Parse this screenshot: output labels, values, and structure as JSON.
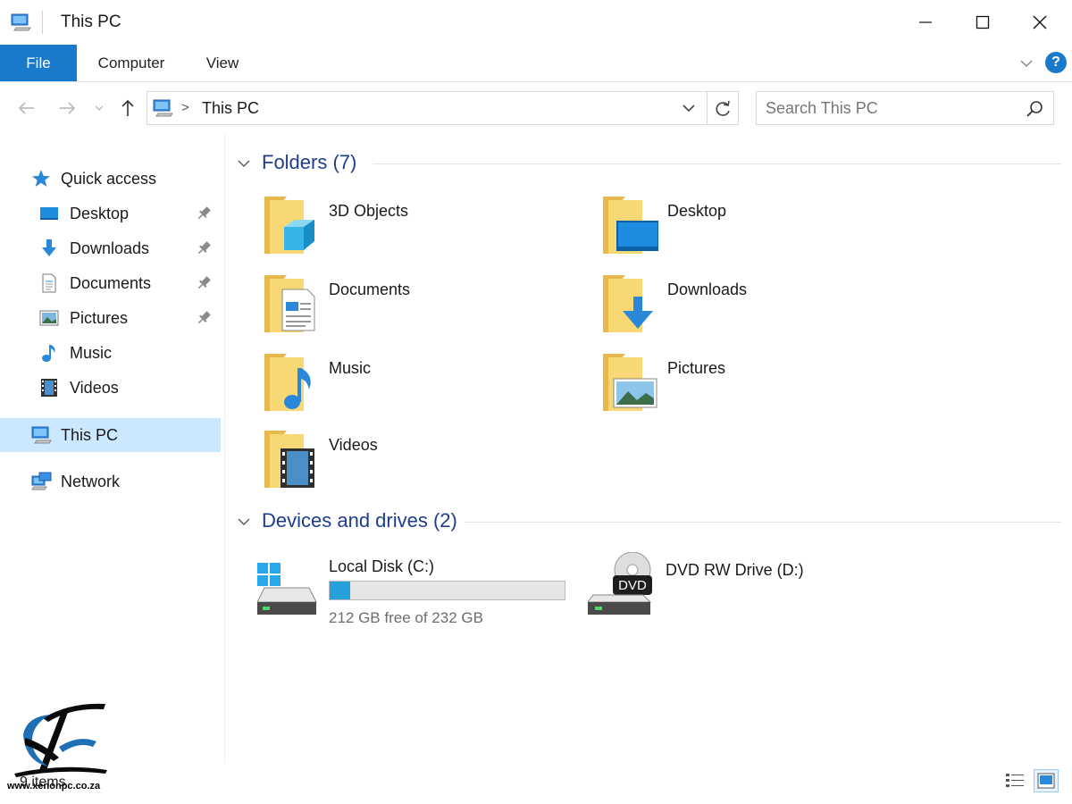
{
  "window": {
    "title": "This PC"
  },
  "ribbon": {
    "tabs": [
      {
        "label": "File"
      },
      {
        "label": "Computer"
      },
      {
        "label": "View"
      }
    ],
    "help_label": "?"
  },
  "address": {
    "path": "This PC",
    "separator": ">"
  },
  "search": {
    "placeholder": "Search This PC"
  },
  "sidebar": {
    "quick_access": "Quick access",
    "pinned": [
      {
        "label": "Desktop",
        "icon": "desktop-icon"
      },
      {
        "label": "Downloads",
        "icon": "downloads-icon"
      },
      {
        "label": "Documents",
        "icon": "documents-icon"
      },
      {
        "label": "Pictures",
        "icon": "pictures-icon"
      }
    ],
    "unpinned": [
      {
        "label": "Music",
        "icon": "music-icon"
      },
      {
        "label": "Videos",
        "icon": "videos-icon"
      }
    ],
    "this_pc": "This PC",
    "network": "Network"
  },
  "folders": {
    "header": "Folders (7)",
    "items": [
      {
        "name": "3D Objects",
        "icon": "3d-objects-folder-icon"
      },
      {
        "name": "Desktop",
        "icon": "desktop-folder-icon"
      },
      {
        "name": "Documents",
        "icon": "documents-folder-icon"
      },
      {
        "name": "Downloads",
        "icon": "downloads-folder-icon"
      },
      {
        "name": "Music",
        "icon": "music-folder-icon"
      },
      {
        "name": "Pictures",
        "icon": "pictures-folder-icon"
      },
      {
        "name": "Videos",
        "icon": "videos-folder-icon"
      }
    ]
  },
  "devices": {
    "header": "Devices and drives (2)",
    "local_disk": {
      "name": "Local Disk (C:)",
      "free_text": "212 GB free of 232 GB",
      "used_fraction": 0.086,
      "bar_color": "#26a0da"
    },
    "dvd": {
      "name": "DVD RW Drive (D:)",
      "badge": "DVD"
    }
  },
  "status": {
    "item_count": "9 items"
  },
  "watermark": {
    "url": "www.xenonpc.co.za"
  },
  "colors": {
    "accent": "#1979ca",
    "selection": "#cce8ff",
    "group_header": "#1e3d8f",
    "folder_yellow": "#f8d775"
  }
}
